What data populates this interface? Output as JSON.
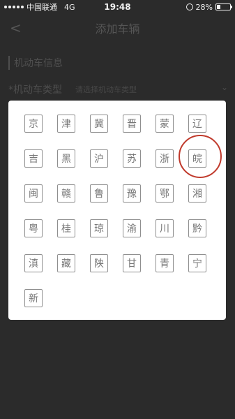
{
  "status_bar": {
    "carrier": "中国联通",
    "network": "4G",
    "time": "19:48",
    "battery_percent": "28%",
    "battery_level": 0.28
  },
  "nav": {
    "title": "添加车辆",
    "back_icon": "<"
  },
  "form": {
    "section_title": "机动车信息",
    "vehicle_type_label": "*机动车类型",
    "vehicle_type_placeholder": "请选择机动车类型",
    "chevron_icon": "⌄"
  },
  "keyboard": {
    "keys": [
      "京",
      "津",
      "冀",
      "晋",
      "蒙",
      "辽",
      "吉",
      "黑",
      "沪",
      "苏",
      "浙",
      "皖",
      "闽",
      "赣",
      "鲁",
      "豫",
      "鄂",
      "湘",
      "粤",
      "桂",
      "琼",
      "渝",
      "川",
      "黔",
      "滇",
      "藏",
      "陕",
      "甘",
      "青",
      "宁",
      "新"
    ],
    "highlighted_key": "皖",
    "highlight_color": "#c0392b"
  }
}
